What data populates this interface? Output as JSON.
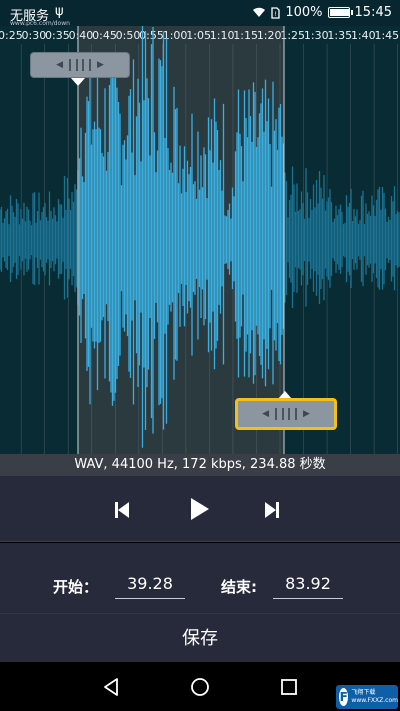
{
  "status_bar": {
    "carrier": "无服务",
    "usb_icon": "usb-icon",
    "battery": "100%",
    "time": "15:45",
    "watermark": "www.pc6.com/down"
  },
  "timeline": {
    "labels": [
      "0:25",
      "0:30",
      "0:35",
      "0:40",
      "0:45",
      "0:50",
      "0:55",
      "1:00",
      "1:05",
      "1:10",
      "1:15",
      "1:20",
      "1:25",
      "1:30",
      "1:35",
      "1:40",
      "1:45"
    ]
  },
  "audio_info": "WAV, 44100 Hz, 172 kbps, 234.88 秒数",
  "controls": {
    "prev": "skip-previous-icon",
    "play": "play-icon",
    "next": "skip-next-icon"
  },
  "range": {
    "start_label": "开始：",
    "start_value": "39.28",
    "end_label": "结束:",
    "end_value": "83.92"
  },
  "save_label": "保存",
  "nav": {
    "back": "back-icon",
    "home": "home-icon",
    "recent": "recent-apps-icon"
  },
  "watermark_logo": {
    "mark": "F",
    "line1": "飞翔下载",
    "line2": "www.FXXZ.com"
  }
}
